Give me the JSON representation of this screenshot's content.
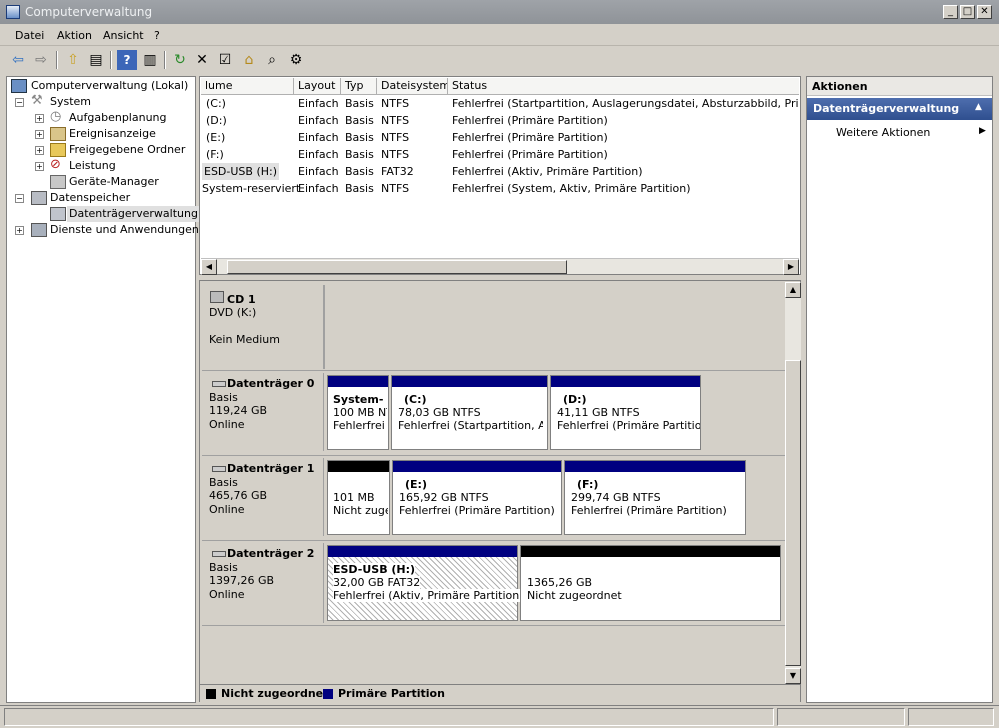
{
  "window": {
    "title": "Computerverwaltung"
  },
  "menu": [
    "Datei",
    "Aktion",
    "Ansicht",
    "?"
  ],
  "tree": {
    "root": "Computerverwaltung (Lokal)",
    "system": "System",
    "tasks": "Aufgabenplanung",
    "events": "Ereignisanzeige",
    "shares": "Freigegebene Ordner",
    "perf": "Leistung",
    "devmgr": "Geräte-Manager",
    "storage": "Datenspeicher",
    "diskmgmt": "Datenträgerverwaltung",
    "services": "Dienste und Anwendungen"
  },
  "volume_list": {
    "columns": [
      "lume",
      "Layout",
      "Typ",
      "Dateisystem",
      "Status"
    ],
    "rows": [
      [
        "(C:)",
        "Einfach",
        "Basis",
        "NTFS",
        "Fehlerfrei (Startpartition, Auslagerungsdatei, Absturzabbild, Primäre Par"
      ],
      [
        "(D:)",
        "Einfach",
        "Basis",
        "NTFS",
        "Fehlerfrei (Primäre Partition)"
      ],
      [
        "(E:)",
        "Einfach",
        "Basis",
        "NTFS",
        "Fehlerfrei (Primäre Partition)"
      ],
      [
        "(F:)",
        "Einfach",
        "Basis",
        "NTFS",
        "Fehlerfrei (Primäre Partition)"
      ],
      [
        "ESD-USB (H:)",
        "Einfach",
        "Basis",
        "FAT32",
        "Fehlerfrei (Aktiv, Primäre Partition)"
      ],
      [
        "System-reserviert",
        "Einfach",
        "Basis",
        "NTFS",
        "Fehlerfrei (System, Aktiv, Primäre Partition)"
      ]
    ]
  },
  "cd": {
    "name": "CD 1",
    "type": "DVD (K:)",
    "status": "Kein Medium"
  },
  "disk0": {
    "name": "Datenträger 0",
    "type": "Basis",
    "size": "119,24 GB",
    "state": "Online",
    "p1": {
      "name": "System-",
      "size": "100 MB NT",
      "status": "Fehlerfrei"
    },
    "p2": {
      "name": "(C:)",
      "size": "78,03 GB NTFS",
      "status": "Fehlerfrei (Startpartition, Ausl"
    },
    "p3": {
      "name": "(D:)",
      "size": "41,11 GB NTFS",
      "status": "Fehlerfrei (Primäre Partition)"
    }
  },
  "disk1": {
    "name": "Datenträger 1",
    "type": "Basis",
    "size": "465,76 GB",
    "state": "Online",
    "p1": {
      "size": "101 MB",
      "status": "Nicht zuge"
    },
    "p2": {
      "name": "(E:)",
      "size": "165,92 GB NTFS",
      "status": "Fehlerfrei (Primäre Partition)"
    },
    "p3": {
      "name": "(F:)",
      "size": "299,74 GB NTFS",
      "status": "Fehlerfrei (Primäre Partition)"
    }
  },
  "disk2": {
    "name": "Datenträger 2",
    "type": "Basis",
    "size": "1397,26 GB",
    "state": "Online",
    "p1": {
      "name": "ESD-USB  (H:)",
      "size": "32,00 GB FAT32",
      "status": "Fehlerfrei (Aktiv, Primäre Partition)"
    },
    "p2": {
      "size": "1365,26 GB",
      "status": "Nicht zugeordnet"
    }
  },
  "legend": {
    "unallocated": "Nicht zugeordnet",
    "primary": "Primäre Partition"
  },
  "actions": {
    "header": "Aktionen",
    "section": "Datenträgerverwaltung",
    "more": "Weitere Aktionen"
  },
  "colors": {
    "primary": "#000080",
    "unallocated": "#000000",
    "section": "#3a5a9c"
  }
}
